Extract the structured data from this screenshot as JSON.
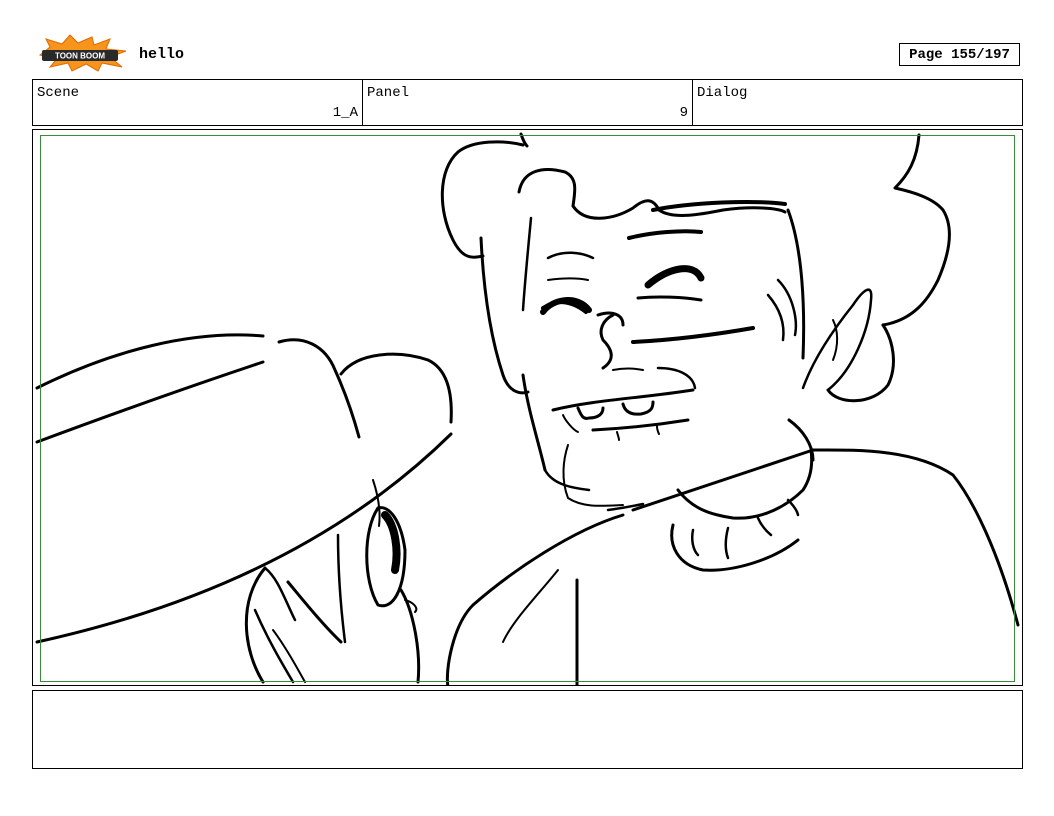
{
  "header": {
    "logo_icon": "toonboom-logo-icon",
    "logo_text": "TOON BOOM",
    "project_title": "hello",
    "page_label": "Page 155/197"
  },
  "info": {
    "scene_label": "Scene",
    "scene_value": "1_A",
    "panel_label": "Panel",
    "panel_value": "9",
    "dialog_label": "Dialog",
    "dialog_value": ""
  },
  "panel": {
    "image_icon": "storyboard-sketch-smiling-character-hat",
    "safe_area_color": "#3b8a3b"
  },
  "notes": {
    "text": ""
  }
}
